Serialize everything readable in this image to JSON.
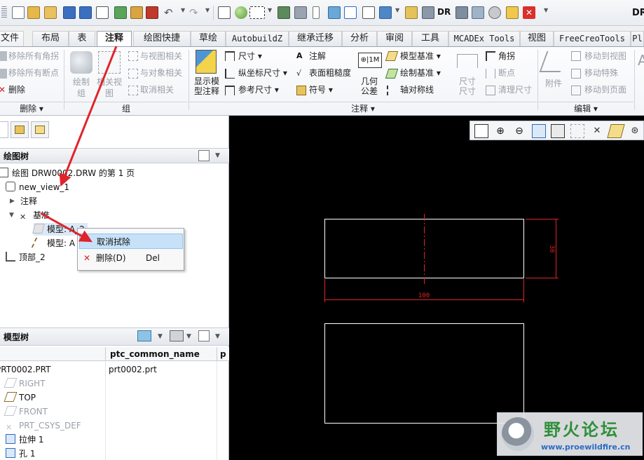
{
  "title_fragment": "DR",
  "tabs": [
    {
      "label": "文件"
    },
    {
      "label": "布局"
    },
    {
      "label": "表"
    },
    {
      "label": "注释"
    },
    {
      "label": "绘图快捷"
    },
    {
      "label": "草绘"
    },
    {
      "label": "AutobuildZ"
    },
    {
      "label": "继承迁移"
    },
    {
      "label": "分析"
    },
    {
      "label": "审阅"
    },
    {
      "label": "工具"
    },
    {
      "label": "MCADEx Tools"
    },
    {
      "label": "视图"
    },
    {
      "label": "FreeCreoTools"
    },
    {
      "label": "Pl"
    }
  ],
  "ribbon": {
    "delete_group": {
      "items": [
        "移除所有角拐",
        "移除所有断点",
        "删除"
      ],
      "label": "删除"
    },
    "group_group": {
      "draw_group": "绘制\n组",
      "related_view": "相关视\n图",
      "items": [
        "与视图相关",
        "与对象相关",
        "取消相关"
      ],
      "label": "组"
    },
    "annotation_group": {
      "show_model_annot": "显示模\n型注释",
      "col1": [
        "尺寸",
        "纵坐标尺寸",
        "参考尺寸"
      ],
      "col2": [
        "注解",
        "表面粗糙度",
        "符号"
      ],
      "gtol": "几何\n公差",
      "col3": [
        "模型基准",
        "绘制基准",
        "轴对称线"
      ],
      "dim_label": "尺寸\n尺寸",
      "col4": [
        "角拐",
        "断点",
        "清理尺寸"
      ],
      "label": "注释"
    },
    "edit_group": {
      "attach": "附件",
      "items": [
        "移动到视图",
        "移动特殊",
        "移动到页面"
      ],
      "label": "编辑"
    }
  },
  "drawing_tree": {
    "header": "绘图树",
    "items": [
      {
        "label": "绘图 DRW0002.DRW 的第 1 页"
      },
      {
        "label": "new_view_1"
      },
      {
        "label": "注释"
      },
      {
        "label": "基准"
      },
      {
        "label": "模型: A_2"
      },
      {
        "label": "模型: A"
      },
      {
        "label": "顶部_2"
      }
    ]
  },
  "context_menu": {
    "items": [
      {
        "label": "取消拭除",
        "shortcut": ""
      },
      {
        "label": "删除(D)",
        "shortcut": "Del"
      }
    ]
  },
  "model_tree": {
    "header": "模型树",
    "columns": [
      "",
      "ptc_common_name",
      "p"
    ],
    "rows": [
      {
        "name": "PRT0002.PRT",
        "common": "prt0002.prt"
      },
      {
        "name": "RIGHT",
        "common": ""
      },
      {
        "name": "TOP",
        "common": ""
      },
      {
        "name": "FRONT",
        "common": ""
      },
      {
        "name": "PRT_CSYS_DEF",
        "common": ""
      },
      {
        "name": "拉伸 1",
        "common": ""
      },
      {
        "name": "孔 1",
        "common": ""
      }
    ]
  },
  "drawing": {
    "dim_horizontal": "100",
    "dim_vertical": "30"
  },
  "watermark": {
    "text": "野火论坛",
    "url": "www.proewildfire.cn"
  },
  "colors": {
    "accent_blue": "#2b6cc4",
    "highlight": "#c7e2f8",
    "annotation_red": "#e0242b",
    "canvas": "#000000"
  }
}
